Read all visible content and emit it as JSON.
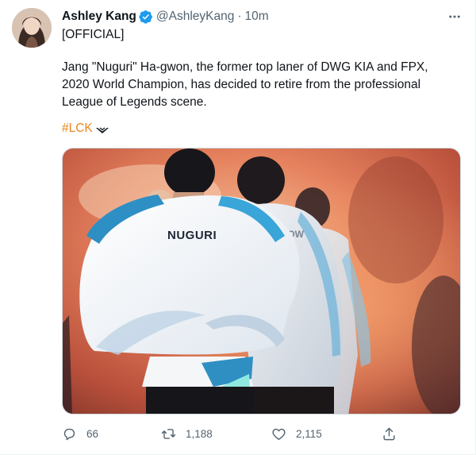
{
  "tweet": {
    "author_name": "Ashley Kang",
    "handle": "@AshleyKang",
    "separator": "·",
    "time": "10m",
    "line1": "[OFFICIAL]",
    "body": "Jang \"Nuguri\" Ha-gwon, the former top laner of DWG KIA and FPX, 2020 World Champion, has decided to retire from the professional League of Legends scene.",
    "hashtag": "#LCK",
    "media": {
      "jacket_text": "NUGURI",
      "jacket_text_2": "KHYOW"
    }
  },
  "actions": {
    "reply_count": "66",
    "retweet_count": "1,188",
    "like_count": "2,115"
  },
  "icons": {
    "verified": "verified-badge-icon",
    "more": "more-options-icon",
    "reply": "reply-icon",
    "retweet": "retweet-icon",
    "like": "heart-icon",
    "share": "share-icon"
  },
  "colors": {
    "verified_blue": "#1d9bf0",
    "hashtag": "#e8871e",
    "muted": "#536471",
    "text": "#0f1419"
  }
}
